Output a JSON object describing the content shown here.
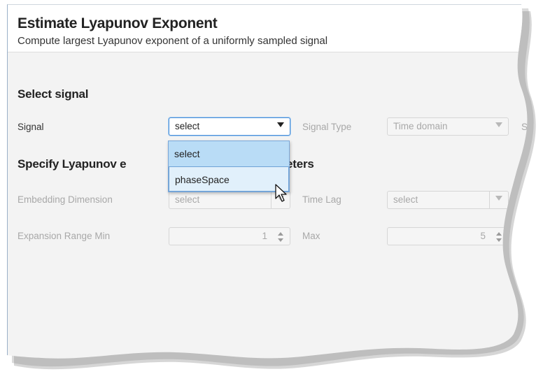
{
  "header": {
    "title": "Estimate Lyapunov Exponent",
    "subtitle": "Compute largest Lyapunov exponent of a uniformly sampled signal"
  },
  "select_signal": {
    "section_title": "Select signal",
    "signal_label": "Signal",
    "signal_value": "select",
    "signal_type_label": "Signal Type",
    "signal_type_value": "Time domain",
    "truncated_label": "S",
    "dropdown_options": [
      "select",
      "phaseSpace"
    ],
    "selected_option": "select",
    "hovered_option": "phaseSpace"
  },
  "params": {
    "section_title_start": "Specify Lyapunov e",
    "section_title_end": "eters",
    "embedding_dimension_label": "Embedding Dimension",
    "embedding_dimension_value": "select",
    "time_lag_label": "Time Lag",
    "time_lag_value": "select",
    "expansion_range_label": "Expansion Range  Min",
    "expansion_min_value": "1",
    "max_label": "Max",
    "expansion_max_value": "5"
  },
  "colors": {
    "accent": "#4a90d9",
    "selected_bg": "#b9dcf6",
    "hover_bg": "#e1f0fb",
    "panel_bg": "#f3f3f3",
    "disabled_text": "#a8a8a8"
  },
  "icons": {
    "dropdown": "triangle-down-icon",
    "spinner": "up-down-arrows-icon",
    "cursor": "mouse-pointer-icon"
  }
}
